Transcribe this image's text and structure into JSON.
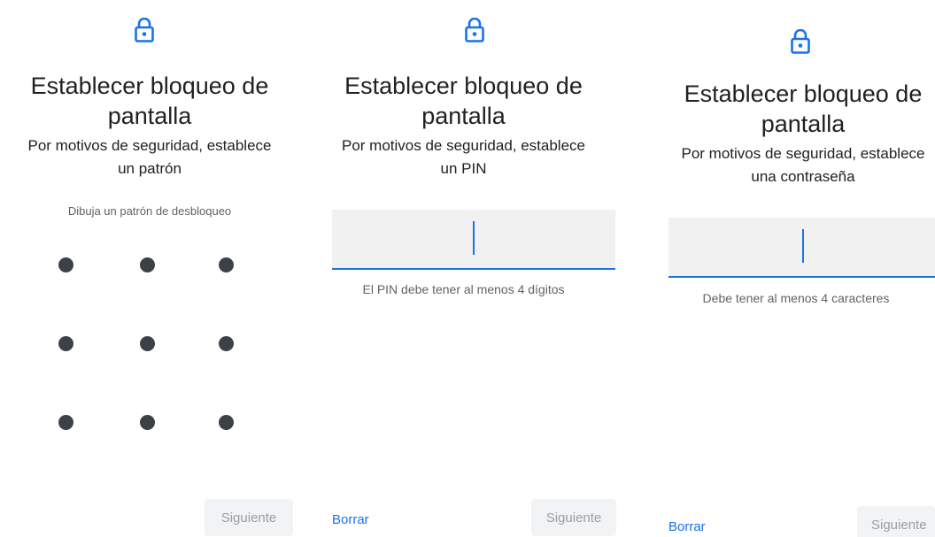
{
  "colors": {
    "accent": "#1a73e8",
    "text_primary": "#202124",
    "text_secondary": "#5f6368",
    "pattern_dot": "#3c4148",
    "field_background": "#f1f1f1",
    "disabled_button_background": "#f1f3f4",
    "disabled_button_text": "#9aa0a6"
  },
  "pattern_screen": {
    "icon": "lock-icon",
    "title_line1": "Establecer bloqueo de",
    "title_line2": "pantalla",
    "subtitle_line1": "Por motivos de seguridad, establece",
    "subtitle_line2": "un patrón",
    "hint": "Dibuja un patrón de desbloqueo",
    "grid": {
      "rows": 3,
      "columns": 3
    },
    "next_button": {
      "label": "Siguiente",
      "enabled": false
    }
  },
  "pin_screen": {
    "icon": "lock-icon",
    "title_line1": "Establecer bloqueo de",
    "title_line2": "pantalla",
    "subtitle_line1": "Por motivos de seguridad, establece",
    "subtitle_line2": "un PIN",
    "input_value": "",
    "hint": "El PIN debe tener al menos 4 dígitos",
    "clear_button": {
      "label": "Borrar"
    },
    "next_button": {
      "label": "Siguiente",
      "enabled": false
    }
  },
  "password_screen": {
    "icon": "lock-icon",
    "title_line1": "Establecer bloqueo de",
    "title_line2": "pantalla",
    "subtitle_line1": "Por motivos de seguridad, establece",
    "subtitle_line2": "una contraseña",
    "input_value": "",
    "hint": "Debe tener al menos 4 caracteres",
    "clear_button": {
      "label": "Borrar"
    },
    "next_button": {
      "label": "Siguiente",
      "enabled": false
    }
  }
}
